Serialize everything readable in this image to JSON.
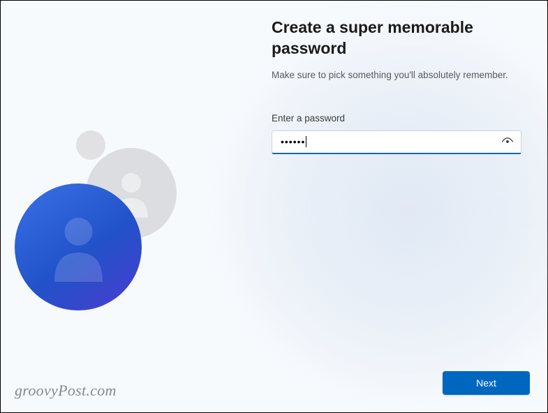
{
  "header": {
    "title": "Create a super memorable password",
    "subtitle": "Make sure to pick something you'll absolutely remember."
  },
  "form": {
    "password_label": "Enter a password",
    "password_value_masked": "••••••"
  },
  "actions": {
    "next_label": "Next"
  },
  "watermark": "groovyPost.com"
}
